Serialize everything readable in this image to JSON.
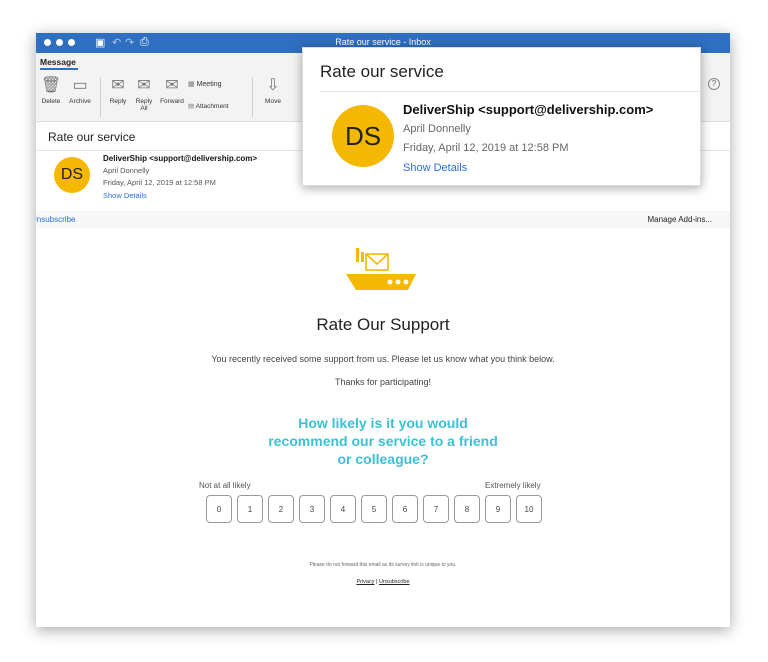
{
  "window": {
    "title": "Rate our service - Inbox"
  },
  "ribbon": {
    "tab": "Message",
    "buttons": {
      "delete": "Delete",
      "archive": "Archive",
      "reply": "Reply",
      "reply_all_line1": "Reply",
      "reply_all_line2": "All",
      "forward": "Forward",
      "meeting": "Meeting",
      "attachment": "Attachment",
      "move": "Move"
    }
  },
  "message": {
    "subject": "Rate our service",
    "sender": "DeliverShip <support@delivership.com>",
    "recipient": "April Donnelly",
    "date": "Friday, April 12, 2019 at 12:58 PM",
    "show_details": "Show Details",
    "avatar_initials": "DS",
    "avatar_color": "#f5b800"
  },
  "infobar": {
    "unsubscribe": "Unsubscribe",
    "manage_addins": "Manage Add-ins..."
  },
  "email": {
    "heading": "Rate Our Support",
    "intro": "You recently received some support from us. Please let us know what you think below.",
    "thanks": "Thanks for participating!",
    "question_line1": "How likely is it you would",
    "question_line2": "recommend our service to a friend",
    "question_line3": "or colleague?",
    "scale_low": "Not at all likely",
    "scale_high": "Extremely likely",
    "scale": [
      "0",
      "1",
      "2",
      "3",
      "4",
      "5",
      "6",
      "7",
      "8",
      "9",
      "10"
    ],
    "footnote": "Please do not forward this email as its survey link is unique to you.",
    "privacy": "Privacy",
    "separator": "|",
    "unsubscribe": "Unsubscribe",
    "accent_color": "#3cc1d4",
    "brand_color": "#f5b800"
  },
  "popup": {
    "title": "Rate our service",
    "sender": "DeliverShip <support@delivership.com>",
    "recipient": "April Donnelly",
    "date": "Friday, April 12, 2019 at 12:58 PM",
    "show_details": "Show Details",
    "avatar_initials": "DS"
  }
}
